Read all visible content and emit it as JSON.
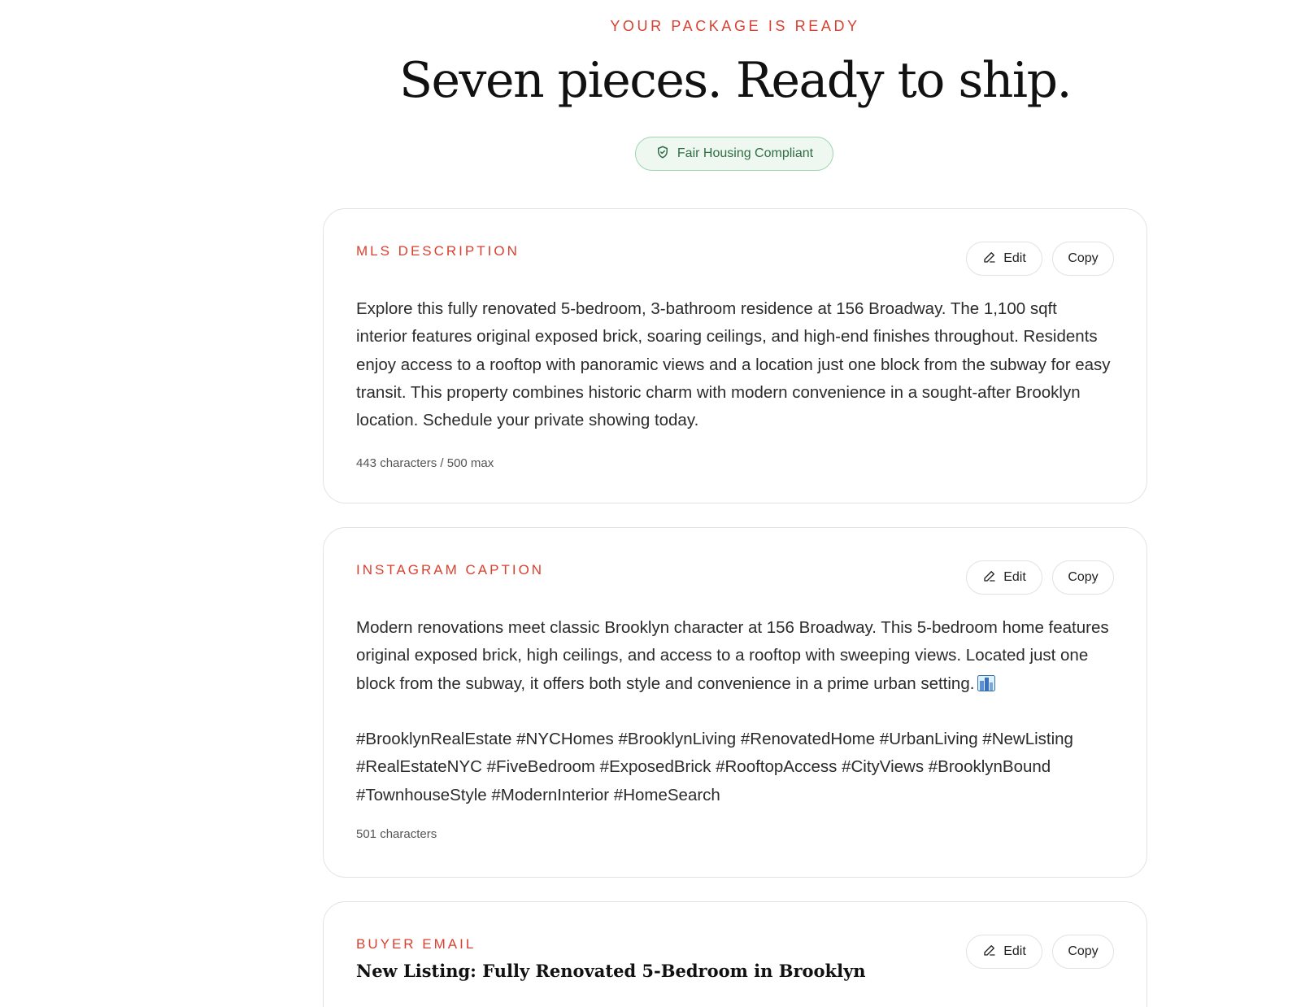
{
  "header": {
    "eyebrow": "YOUR PACKAGE IS READY",
    "title": "Seven pieces. Ready to ship.",
    "badge": "Fair Housing Compliant"
  },
  "actions": {
    "edit_label": "Edit",
    "copy_label": "Copy"
  },
  "cards": [
    {
      "label": "MLS DESCRIPTION",
      "body": "Explore this fully renovated 5-bedroom, 3-bathroom residence at 156 Broadway. The 1,100 sqft interior features original exposed brick, soaring ceilings, and high-end finishes throughout. Residents enjoy access to a rooftop with panoramic views and a location just one block from the subway for easy transit. This property combines historic charm with modern convenience in a sought-after Brooklyn location. Schedule your private showing today.",
      "char_count": "443 characters / 500 max"
    },
    {
      "label": "INSTAGRAM CAPTION",
      "body": "Modern renovations meet classic Brooklyn character at 156 Broadway. This 5-bedroom home features original exposed brick, high ceilings, and access to a rooftop with sweeping views. Located just one block from the subway, it offers both style and convenience in a prime urban setting.",
      "hashtags": "#BrooklynRealEstate #NYCHomes #BrooklynLiving #RenovatedHome #UrbanLiving #NewListing #RealEstateNYC #FiveBedroom #ExposedBrick #RooftopAccess #CityViews #BrooklynBound #TownhouseStyle #ModernInterior #HomeSearch",
      "char_count": "501 characters"
    },
    {
      "label": "BUYER EMAIL",
      "subject": "New Listing: Fully Renovated 5-Bedroom in Brooklyn"
    }
  ],
  "colors": {
    "accent": "#d9402f",
    "badge_text": "#2f6e43",
    "badge_bg": "#eef8f0",
    "badge_border": "#9ed6ae"
  },
  "icons": {
    "badge": "shield-check-icon",
    "edit": "pencil-icon",
    "caption_emoji": "cityscape-emoji"
  }
}
